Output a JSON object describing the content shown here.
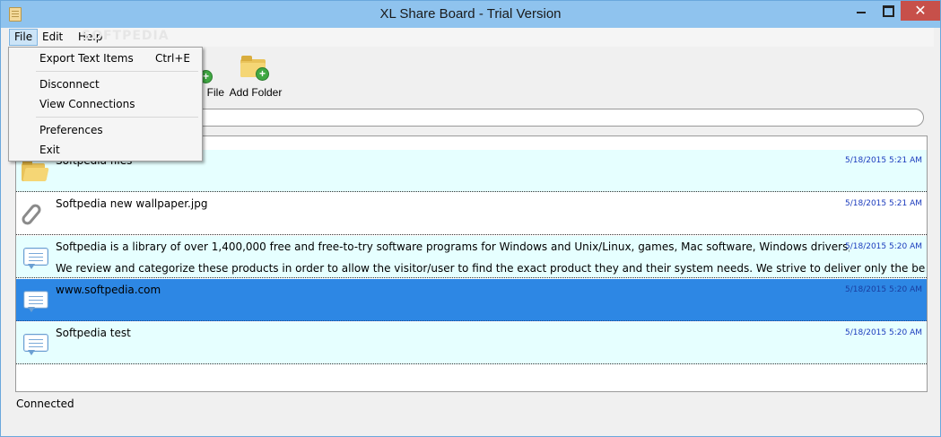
{
  "window": {
    "title": "XL Share Board - Trial Version",
    "close_glyph": "✕"
  },
  "menubar": {
    "file": "File",
    "edit": "Edit",
    "help": "Help"
  },
  "file_menu": {
    "items": [
      {
        "label": "Export Text Items",
        "shortcut": "Ctrl+E"
      },
      {
        "label": "Disconnect"
      },
      {
        "label": "View Connections"
      },
      {
        "label": "Preferences"
      },
      {
        "label": "Exit"
      }
    ]
  },
  "toolbar": {
    "add_file_label_partial": "File",
    "add_folder_label": "Add Folder"
  },
  "watermark": "SOFTPEDIA",
  "items": [
    {
      "type": "folder",
      "text": "Softpedia files",
      "timestamp": "5/18/2015 5:21 AM"
    },
    {
      "type": "file",
      "text": "Softpedia new wallpaper.jpg",
      "timestamp": "5/18/2015 5:21 AM"
    },
    {
      "type": "text",
      "text": "Softpedia is a library of over 1,400,000 free and free-to-try software programs for Windows and Unix/Linux, games, Mac software, Windows drivers, mobile devices an...",
      "text2": "We review and categorize these products in order to allow the visitor/user to find the exact product they and their system needs. We strive to deliver only the best products to the visito...",
      "timestamp": "5/18/2015 5:20 AM"
    },
    {
      "type": "text",
      "text": "www.softpedia.com",
      "timestamp": "5/18/2015 5:20 AM"
    },
    {
      "type": "text",
      "text": "Softpedia test",
      "timestamp": "5/18/2015 5:20 AM"
    }
  ],
  "status": {
    "text": "Connected"
  },
  "colors": {
    "titlebar": "#8fc3ee",
    "selection": "#2d87e4",
    "alt_row": "#e6ffff",
    "timestamp": "#1b3bbd",
    "close": "#c7504a"
  }
}
